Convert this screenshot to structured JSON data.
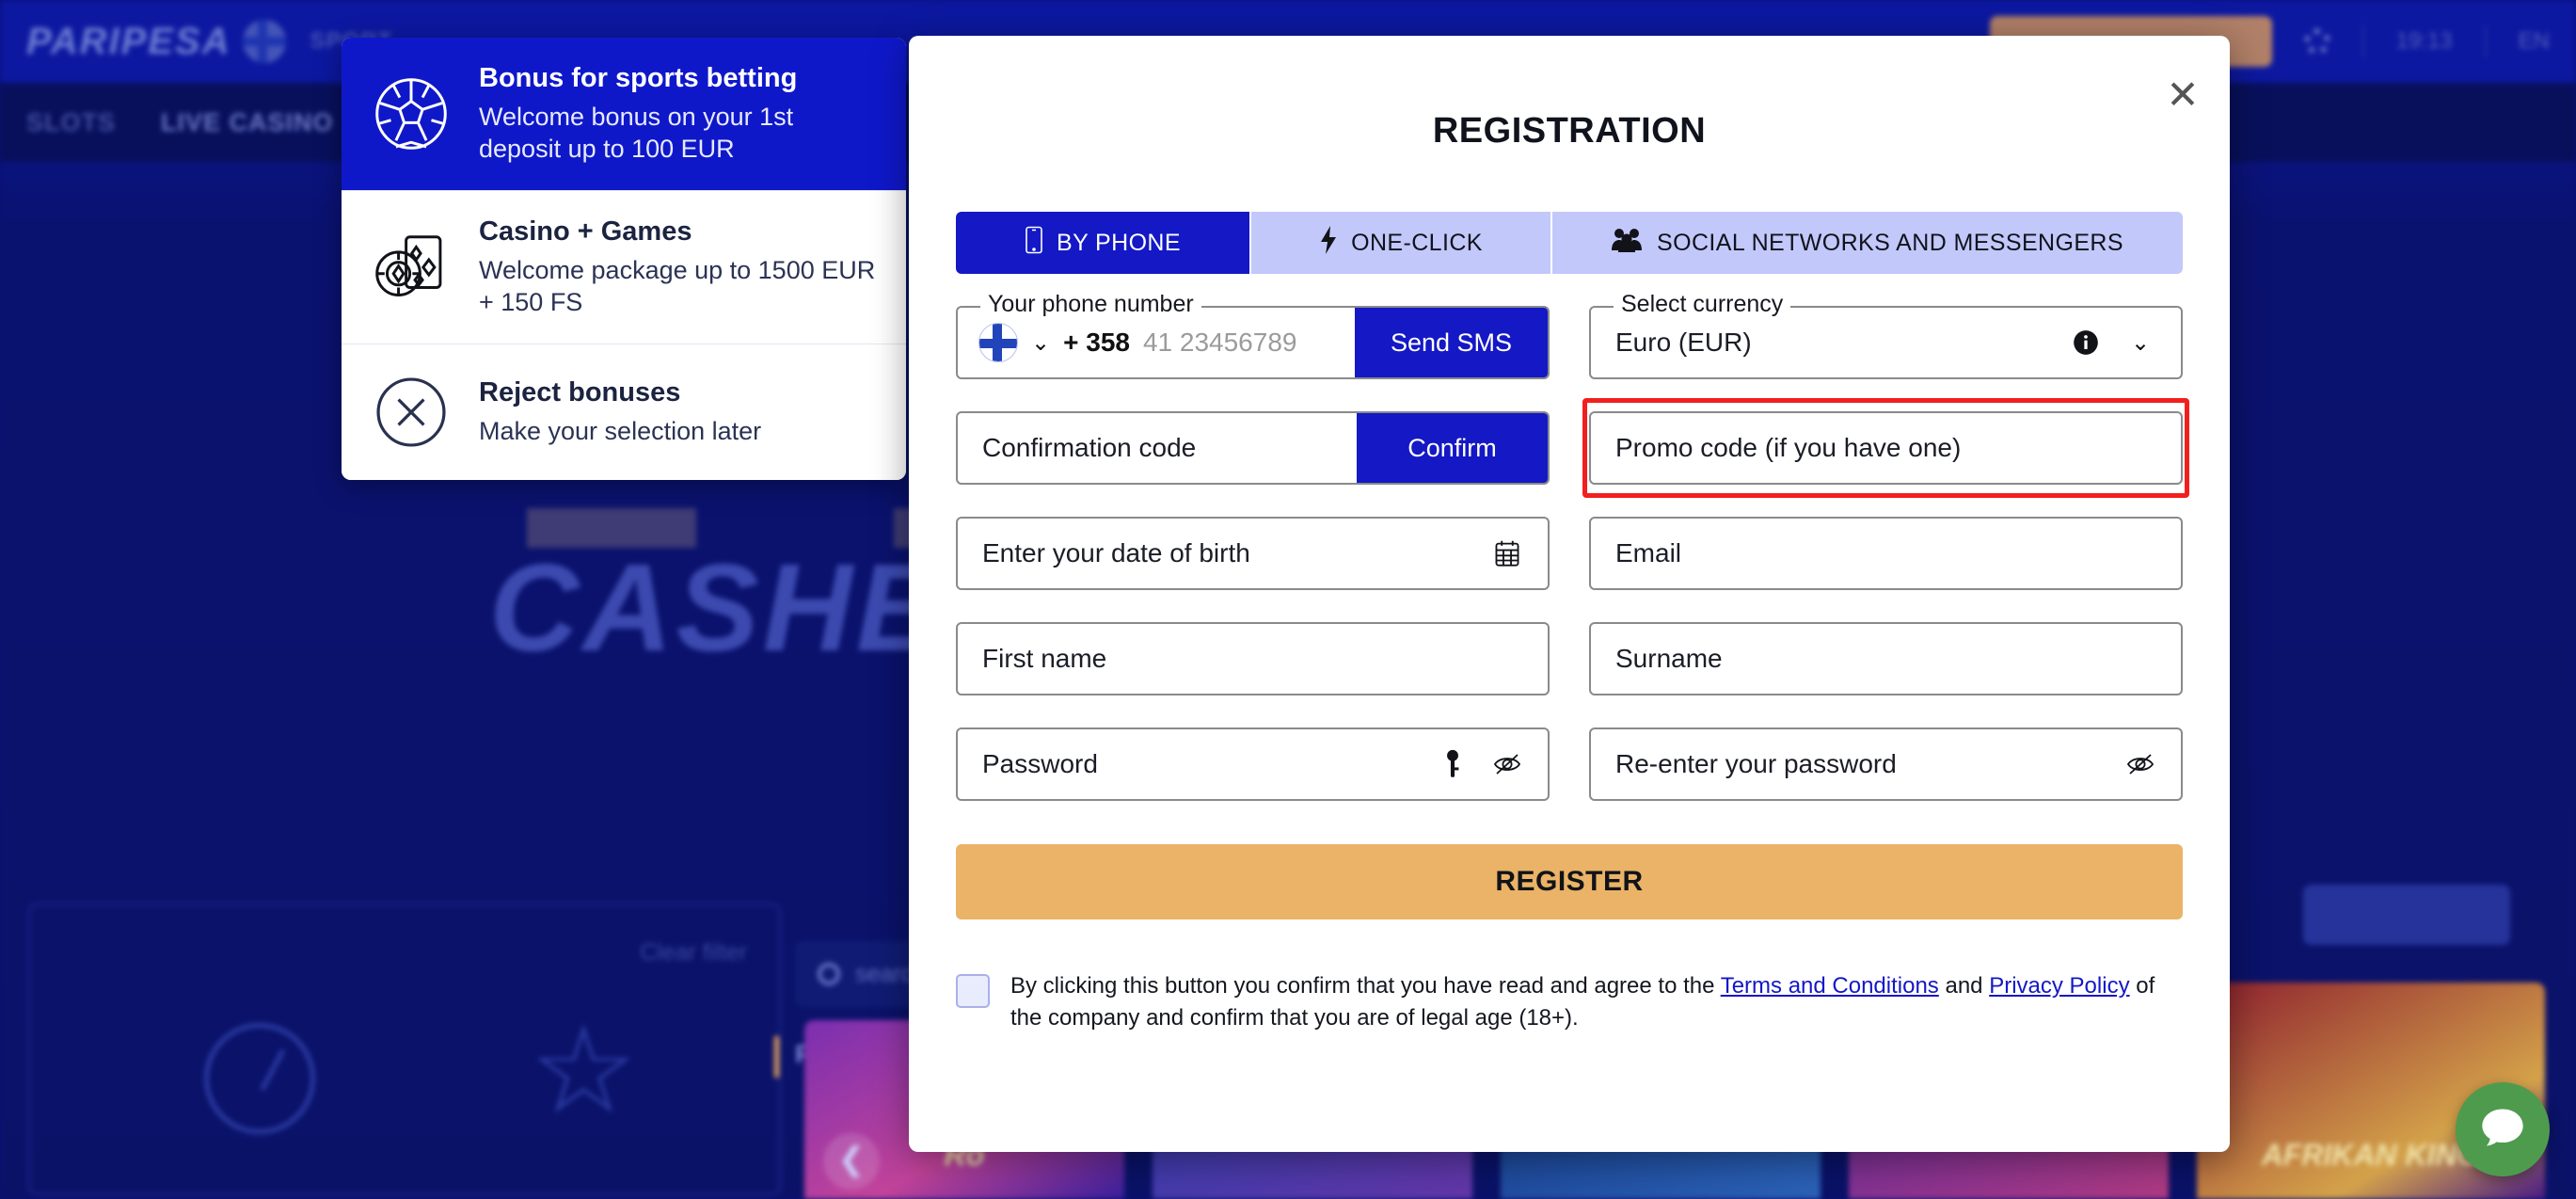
{
  "background": {
    "logo": "PARIPESA",
    "flag_icon": "finland-flag-icon",
    "topnav_label": "SPORT",
    "top_right": {
      "gear_icon": "gear-icon",
      "time": "19:13",
      "language": "EN"
    },
    "subnav": [
      {
        "label": "SLOTS"
      },
      {
        "label": "LIVE CASINO"
      }
    ],
    "hero_title": "CASHE",
    "clear_filter": "Clear filter",
    "search_placeholder": "search",
    "popular_label": "POPULAR",
    "cards": [
      {
        "label": "Ro"
      },
      {
        "label": ""
      },
      {
        "label": ""
      },
      {
        "label": ""
      },
      {
        "label": "AFRIKAN KING"
      }
    ]
  },
  "bonus_panel": {
    "cards": [
      {
        "icon": "soccer-ball-icon",
        "title": "Bonus for sports betting",
        "subtitle": "Welcome bonus on your 1st deposit up to 100 EUR",
        "selected": true
      },
      {
        "icon": "casino-chips-cards-icon",
        "title": "Casino + Games",
        "subtitle": "Welcome package up to 1500 EUR + 150 FS",
        "selected": false
      },
      {
        "icon": "reject-circle-x-icon",
        "title": "Reject bonuses",
        "subtitle": "Make your selection later",
        "selected": false
      }
    ]
  },
  "modal": {
    "title": "REGISTRATION",
    "close_icon": "close-icon",
    "tabs": [
      {
        "label": "BY PHONE",
        "icon": "mobile-phone-icon",
        "selected": true
      },
      {
        "label": "ONE-CLICK",
        "icon": "lightning-bolt-icon",
        "selected": false
      },
      {
        "label": "SOCIAL NETWORKS AND MESSENGERS",
        "icon": "people-group-icon",
        "selected": false
      }
    ],
    "fields": {
      "phone": {
        "legend": "Your phone number",
        "flag_icon": "finland-flag-icon",
        "chevron_icon": "chevron-down-icon",
        "dial_code": "+ 358",
        "placeholder": "41 23456789",
        "button": "Send SMS"
      },
      "currency": {
        "legend": "Select currency",
        "value": "Euro (EUR)",
        "info_icon": "info-icon",
        "chevron_icon": "chevron-down-icon"
      },
      "confirmation_code": {
        "placeholder": "Confirmation code",
        "button": "Confirm"
      },
      "promo_code": {
        "placeholder": "Promo code (if you have one)",
        "highlight_color": "#f21f1f"
      },
      "date_of_birth": {
        "placeholder": "Enter your date of birth",
        "icon": "calendar-icon"
      },
      "email": {
        "placeholder": "Email"
      },
      "first_name": {
        "placeholder": "First name"
      },
      "surname": {
        "placeholder": "Surname"
      },
      "password": {
        "placeholder": "Password",
        "key_icon": "key-icon",
        "eye_icon": "eye-off-icon"
      },
      "password_repeat": {
        "placeholder": "Re-enter your password",
        "eye_icon": "eye-off-icon"
      }
    },
    "register_button": "REGISTER",
    "terms": {
      "prefix": "By clicking this button you confirm that you have read and agree to the ",
      "link1": "Terms and Conditions",
      "middle": " and ",
      "link2": "Privacy Policy",
      "suffix": " of the company and confirm that you are of legal age (18+)."
    }
  },
  "chat": {
    "icon": "chat-bubble-icon",
    "color": "#4e9b4e"
  }
}
